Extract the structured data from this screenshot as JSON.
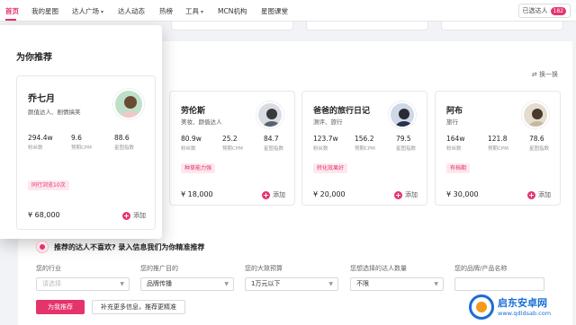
{
  "nav": {
    "items": [
      "首页",
      "我的星图",
      "达人广场",
      "达人动态",
      "热榜",
      "工具",
      "MCN机构",
      "星图课堂"
    ],
    "added_label": "已选达人",
    "added_count": "182"
  },
  "recommend": {
    "title": "为你推荐",
    "swap_label": "换一换",
    "add_label": "添加",
    "cards": [
      {
        "name": "乔七月",
        "tags": "颜值达人、剧情搞笑",
        "stats": [
          {
            "value": "294.4w",
            "label": "粉丝数"
          },
          {
            "value": "9.6",
            "label": "预期CPM"
          },
          {
            "value": "88.6",
            "label": "星图指数"
          }
        ],
        "chip": "同行浏览10次",
        "price": "¥ 68,000"
      },
      {
        "name": "劳伦斯",
        "tags": "美妆、颜值达人",
        "stats": [
          {
            "value": "80.9w",
            "label": "粉丝数"
          },
          {
            "value": "25.2",
            "label": "预期CPM"
          },
          {
            "value": "84.7",
            "label": "星图指数"
          }
        ],
        "chip": "种草能力强",
        "price": "¥ 18,000"
      },
      {
        "name": "爸爸的旅行日记",
        "tags": "测评、旅行",
        "stats": [
          {
            "value": "123.7w",
            "label": "粉丝数"
          },
          {
            "value": "156.2",
            "label": "预期CPM"
          },
          {
            "value": "79.5",
            "label": "星图指数"
          }
        ],
        "chip": "转化效果好",
        "price": "¥ 20,000"
      },
      {
        "name": "阿布",
        "tags": "旅行",
        "stats": [
          {
            "value": "164w",
            "label": "粉丝数"
          },
          {
            "value": "121.8",
            "label": "预期CPM"
          },
          {
            "value": "78.6",
            "label": "星图指数"
          }
        ],
        "chip": "有档期",
        "price": "¥ 30,000"
      }
    ]
  },
  "feedback": {
    "title": "推荐的达人不喜欢? 录入信息我们为你精准推荐",
    "fields": [
      {
        "label": "您的行业",
        "value": "请选择",
        "placeholder": true
      },
      {
        "label": "您的推广目的",
        "value": "品牌传播",
        "placeholder": false
      },
      {
        "label": "您的大致预算",
        "value": "1万元以下",
        "placeholder": false
      },
      {
        "label": "您想选择的达人数量",
        "value": "不限",
        "placeholder": false
      },
      {
        "label": "您的品牌/产品名称",
        "value": "",
        "placeholder": false
      }
    ],
    "primary_button": "为我推荐",
    "secondary_button": "补充更多信息，推荐更精准"
  },
  "watermark": {
    "line1": "启东安卓网",
    "line2": "www.qdldsab.com"
  },
  "colors": {
    "accent": "#e5336b",
    "watermark": "#1a6dd6"
  }
}
